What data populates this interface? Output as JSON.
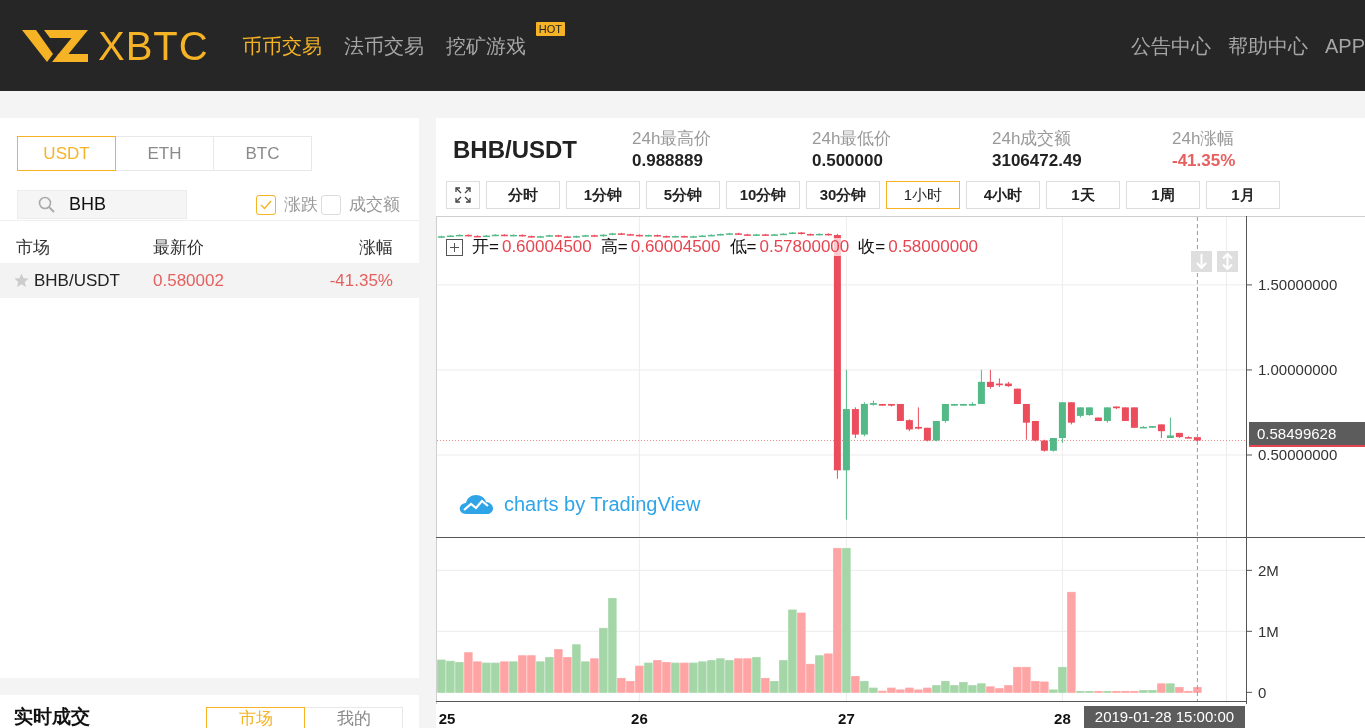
{
  "header": {
    "logo": "XBTC",
    "nav": [
      {
        "label": "币币交易",
        "selected": true
      },
      {
        "label": "法币交易",
        "selected": false
      },
      {
        "label": "挖矿游戏",
        "selected": false,
        "badge": "HOT"
      }
    ],
    "links": [
      "公告中心",
      "帮助中心",
      "APP"
    ]
  },
  "market_panel": {
    "tabs": [
      {
        "label": "USDT",
        "selected": true
      },
      {
        "label": "ETH",
        "selected": false
      },
      {
        "label": "BTC",
        "selected": false
      }
    ],
    "search": {
      "value": "BHB"
    },
    "filters": [
      {
        "label": "涨跌",
        "checked": true
      },
      {
        "label": "成交额",
        "checked": false
      }
    ],
    "columns": [
      "市场",
      "最新价",
      "涨幅"
    ],
    "rows": [
      {
        "pair": "BHB/USDT",
        "price": "0.580002",
        "change": "-41.35%",
        "down": true,
        "starred": false,
        "selected": true
      }
    ]
  },
  "trades_panel": {
    "title": "实时成交",
    "tabs": [
      {
        "label": "市场",
        "selected": true
      },
      {
        "label": "我的",
        "selected": false
      }
    ]
  },
  "ticker": {
    "pair": "BHB/USDT",
    "stats": [
      {
        "label": "24h最高价",
        "value": "0.988889",
        "down": false
      },
      {
        "label": "24h最低价",
        "value": "0.500000",
        "down": false
      },
      {
        "label": "24h成交额",
        "value": "3106472.49",
        "down": false
      },
      {
        "label": "24h涨幅",
        "value": "-41.35%",
        "down": true
      }
    ]
  },
  "intervals": [
    {
      "label": "分时",
      "selected": false
    },
    {
      "label": "1分钟",
      "selected": false
    },
    {
      "label": "5分钟",
      "selected": false
    },
    {
      "label": "10分钟",
      "selected": false
    },
    {
      "label": "30分钟",
      "selected": false
    },
    {
      "label": "1小时",
      "selected": true
    },
    {
      "label": "4小时",
      "selected": false
    },
    {
      "label": "1天",
      "selected": false
    },
    {
      "label": "1周",
      "selected": false
    },
    {
      "label": "1月",
      "selected": false
    }
  ],
  "chart": {
    "legend": {
      "down": true,
      "items": [
        {
          "label": "开=",
          "value": "0.60004500"
        },
        {
          "label": "高=",
          "value": "0.60004500"
        },
        {
          "label": "低=",
          "value": "0.57800000"
        },
        {
          "label": "收=",
          "value": "0.58000000"
        }
      ]
    },
    "candles": {
      "chart_data": {
        "type": "candlestick",
        "grid": true,
        "categories": [
          null,
          null,
          null,
          null,
          null,
          null,
          null,
          null,
          null,
          null,
          null,
          null,
          null,
          null,
          null,
          null,
          null,
          null,
          null,
          null,
          null,
          null,
          null,
          null,
          null,
          null,
          null,
          null,
          null,
          null,
          null,
          null,
          null,
          null,
          null,
          null,
          null,
          null,
          null,
          null,
          null,
          null,
          null,
          null,
          null,
          null,
          null,
          null,
          null,
          null,
          null,
          null,
          null,
          null,
          null,
          null,
          null,
          null,
          null,
          null,
          null,
          null,
          null,
          null,
          null,
          null,
          null,
          null,
          null,
          null,
          null,
          null,
          null,
          null,
          null,
          null,
          null,
          null,
          null,
          null,
          null,
          null,
          null,
          null,
          null
        ],
        "ylim": [
          0.015,
          1.905
        ],
        "yticks": [
          {
            "value": 1.5,
            "label": "1.50000000"
          },
          {
            "value": 1,
            "label": "1.00000000"
          },
          {
            "value": 0.5,
            "label": "0.50000000"
          }
        ],
        "ref_lines": [
          {
            "axis": "y",
            "value": 0.585
          }
        ],
        "ohlc": [
          [
            1.78,
            1.789,
            1.777,
            1.786
          ],
          [
            1.786,
            1.793,
            1.783,
            1.79
          ],
          [
            1.79,
            1.797,
            1.787,
            1.794
          ],
          [
            1.794,
            1.797,
            1.785,
            1.788
          ],
          [
            1.788,
            1.791,
            1.781,
            1.784
          ],
          [
            1.784,
            1.793,
            1.781,
            1.79
          ],
          [
            1.79,
            1.798,
            1.787,
            1.795
          ],
          [
            1.795,
            1.798,
            1.786,
            1.789
          ],
          [
            1.789,
            1.797,
            1.786,
            1.794
          ],
          [
            1.794,
            1.797,
            1.784,
            1.787
          ],
          [
            1.787,
            1.79,
            1.778,
            1.781
          ],
          [
            1.781,
            1.789,
            1.778,
            1.786
          ],
          [
            1.786,
            1.795,
            1.783,
            1.792
          ],
          [
            1.792,
            1.795,
            1.782,
            1.785
          ],
          [
            1.785,
            1.788,
            1.776,
            1.779
          ],
          [
            1.779,
            1.79,
            1.776,
            1.787
          ],
          [
            1.787,
            1.795,
            1.784,
            1.792
          ],
          [
            1.792,
            1.795,
            1.783,
            1.786
          ],
          [
            1.786,
            1.798,
            1.783,
            1.795
          ],
          [
            1.795,
            1.806,
            1.792,
            1.803
          ],
          [
            1.803,
            1.806,
            1.795,
            1.798
          ],
          [
            1.798,
            1.801,
            1.791,
            1.794
          ],
          [
            1.794,
            1.797,
            1.785,
            1.788
          ],
          [
            1.788,
            1.796,
            1.785,
            1.793
          ],
          [
            1.793,
            1.796,
            1.784,
            1.787
          ],
          [
            1.787,
            1.79,
            1.779,
            1.782
          ],
          [
            1.782,
            1.79,
            1.779,
            1.787
          ],
          [
            1.787,
            1.79,
            1.779,
            1.782
          ],
          [
            1.782,
            1.789,
            1.779,
            1.786
          ],
          [
            1.786,
            1.793,
            1.783,
            1.79
          ],
          [
            1.79,
            1.797,
            1.787,
            1.794
          ],
          [
            1.794,
            1.802,
            1.791,
            1.799
          ],
          [
            1.799,
            1.806,
            1.796,
            1.803
          ],
          [
            1.803,
            1.806,
            1.794,
            1.797
          ],
          [
            1.797,
            1.8,
            1.788,
            1.791
          ],
          [
            1.791,
            1.8,
            1.788,
            1.797
          ],
          [
            1.797,
            1.8,
            1.79,
            1.793
          ],
          [
            1.793,
            1.8,
            1.79,
            1.797
          ],
          [
            1.797,
            1.804,
            1.794,
            1.801
          ],
          [
            1.801,
            1.811,
            1.798,
            1.808
          ],
          [
            1.808,
            1.811,
            1.796,
            1.799
          ],
          [
            1.799,
            1.802,
            1.791,
            1.794
          ],
          [
            1.794,
            1.803,
            1.791,
            1.8
          ],
          [
            1.8,
            1.803,
            1.79,
            1.793
          ],
          [
            1.793,
            1.8,
            0.36,
            0.41
          ],
          [
            0.41,
            1.0,
            0.12,
            0.77
          ],
          [
            0.77,
            0.78,
            0.6,
            0.62
          ],
          [
            0.62,
            0.81,
            0.61,
            0.8
          ],
          [
            0.795,
            0.82,
            0.79,
            0.805
          ],
          [
            0.8,
            0.8,
            0.79,
            0.79
          ],
          [
            0.8,
            0.8,
            0.785,
            0.79
          ],
          [
            0.8,
            0.8,
            0.7,
            0.7
          ],
          [
            0.705,
            0.71,
            0.64,
            0.65
          ],
          [
            0.665,
            0.78,
            0.65,
            0.655
          ],
          [
            0.66,
            0.66,
            0.58,
            0.585
          ],
          [
            0.585,
            0.7,
            0.58,
            0.7
          ],
          [
            0.7,
            0.8,
            0.69,
            0.8
          ],
          [
            0.79,
            0.8,
            0.79,
            0.8
          ],
          [
            0.79,
            0.8,
            0.79,
            0.8
          ],
          [
            0.79,
            0.81,
            0.79,
            0.8
          ],
          [
            0.8,
            1.0,
            0.8,
            0.93
          ],
          [
            0.93,
            1.0,
            0.89,
            0.9
          ],
          [
            0.92,
            0.95,
            0.9,
            0.91
          ],
          [
            0.92,
            0.93,
            0.9,
            0.905
          ],
          [
            0.89,
            0.89,
            0.8,
            0.8
          ],
          [
            0.8,
            0.8,
            0.59,
            0.69
          ],
          [
            0.7,
            0.7,
            0.58,
            0.585
          ],
          [
            0.585,
            0.59,
            0.52,
            0.525
          ],
          [
            0.525,
            0.6,
            0.52,
            0.6
          ],
          [
            0.6,
            0.81,
            0.57,
            0.81
          ],
          [
            0.81,
            0.81,
            0.68,
            0.69
          ],
          [
            0.73,
            0.78,
            0.72,
            0.78
          ],
          [
            0.735,
            0.78,
            0.73,
            0.78
          ],
          [
            0.72,
            0.72,
            0.7,
            0.7
          ],
          [
            0.7,
            0.78,
            0.69,
            0.78
          ],
          [
            0.785,
            0.785,
            0.77,
            0.775
          ],
          [
            0.78,
            0.78,
            0.7,
            0.7
          ],
          [
            0.78,
            0.78,
            0.66,
            0.66
          ],
          [
            0.66,
            0.67,
            0.66,
            0.665
          ],
          [
            0.66,
            0.67,
            0.66,
            0.67
          ],
          [
            0.68,
            0.68,
            0.6,
            0.64
          ],
          [
            0.6,
            0.72,
            0.6,
            0.615
          ],
          [
            0.63,
            0.63,
            0.6,
            0.605
          ],
          [
            0.605,
            0.61,
            0.6,
            0.6
          ],
          [
            0.605,
            0.605,
            0.58,
            0.585
          ]
        ]
      }
    },
    "last_price": "0.58499628",
    "crosshair_time": "2019-01-28 15:00:00",
    "attribution": "charts by TradingView",
    "volume": {
      "chart_data": {
        "type": "bar",
        "grid": true,
        "categories": [
          "25",
          null,
          null,
          null,
          null,
          null,
          null,
          null,
          null,
          null,
          null,
          null,
          null,
          null,
          null,
          null,
          null,
          null,
          null,
          null,
          null,
          null,
          "26",
          null,
          null,
          null,
          null,
          null,
          null,
          null,
          null,
          null,
          null,
          null,
          null,
          null,
          null,
          null,
          null,
          null,
          null,
          null,
          null,
          null,
          null,
          "27",
          null,
          null,
          null,
          null,
          null,
          null,
          null,
          null,
          null,
          null,
          null,
          null,
          null,
          null,
          null,
          null,
          null,
          null,
          null,
          null,
          null,
          null,
          null,
          "28",
          null,
          null,
          null,
          null,
          null,
          null,
          null,
          null,
          null,
          null,
          null,
          null,
          null,
          null,
          null
        ],
        "ylim": [
          -150000,
          2530000
        ],
        "yticks": [
          {
            "value": 0,
            "label": "0"
          },
          {
            "value": 1000000,
            "label": "1M"
          },
          {
            "value": 2000000,
            "label": "2M"
          }
        ],
        "series": [
          {
            "color": "#a5d6a7",
            "values": [
              530000,
              510000,
              490000,
              null,
              null,
              480000,
              480000,
              null,
              500000,
              null,
              null,
              500000,
              570000,
              null,
              null,
              780000,
              500000,
              null,
              1050000,
              1540000,
              null,
              null,
              null,
              480000,
              null,
              null,
              480000,
              null,
              480000,
              500000,
              520000,
              550000,
              520000,
              null,
              null,
              570000,
              null,
              180000,
              520000,
              1350000,
              null,
              null,
              600000,
              null,
              null,
              2360000,
              null,
              180000,
              70000,
              null,
              null,
              null,
              null,
              null,
              null,
              110000,
              180000,
              110000,
              160000,
              110000,
              140000,
              null,
              null,
              null,
              null,
              null,
              null,
              null,
              40000,
              410000,
              null,
              10000,
              10000,
              null,
              10000,
              null,
              null,
              null,
              30000,
              30000,
              null,
              140000,
              null,
              null,
              null
            ]
          },
          {
            "color": "#ffa4a4",
            "values": [
              null,
              null,
              null,
              650000,
              500000,
              null,
              null,
              500000,
              null,
              600000,
              600000,
              null,
              null,
              700000,
              570000,
              null,
              null,
              550000,
              null,
              null,
              230000,
              180000,
              430000,
              null,
              520000,
              490000,
              null,
              480000,
              null,
              null,
              null,
              null,
              null,
              550000,
              550000,
              null,
              230000,
              null,
              null,
              null,
              1300000,
              460000,
              null,
              630000,
              2360000,
              null,
              260000,
              null,
              null,
              20000,
              70000,
              40000,
              70000,
              40000,
              70000,
              null,
              null,
              null,
              null,
              null,
              null,
              90000,
              60000,
              110000,
              410000,
              410000,
              180000,
              170000,
              null,
              null,
              1640000,
              null,
              null,
              10000,
              null,
              10000,
              10000,
              10000,
              null,
              null,
              140000,
              null,
              80000,
              10000,
              80000
            ]
          }
        ]
      }
    }
  }
}
